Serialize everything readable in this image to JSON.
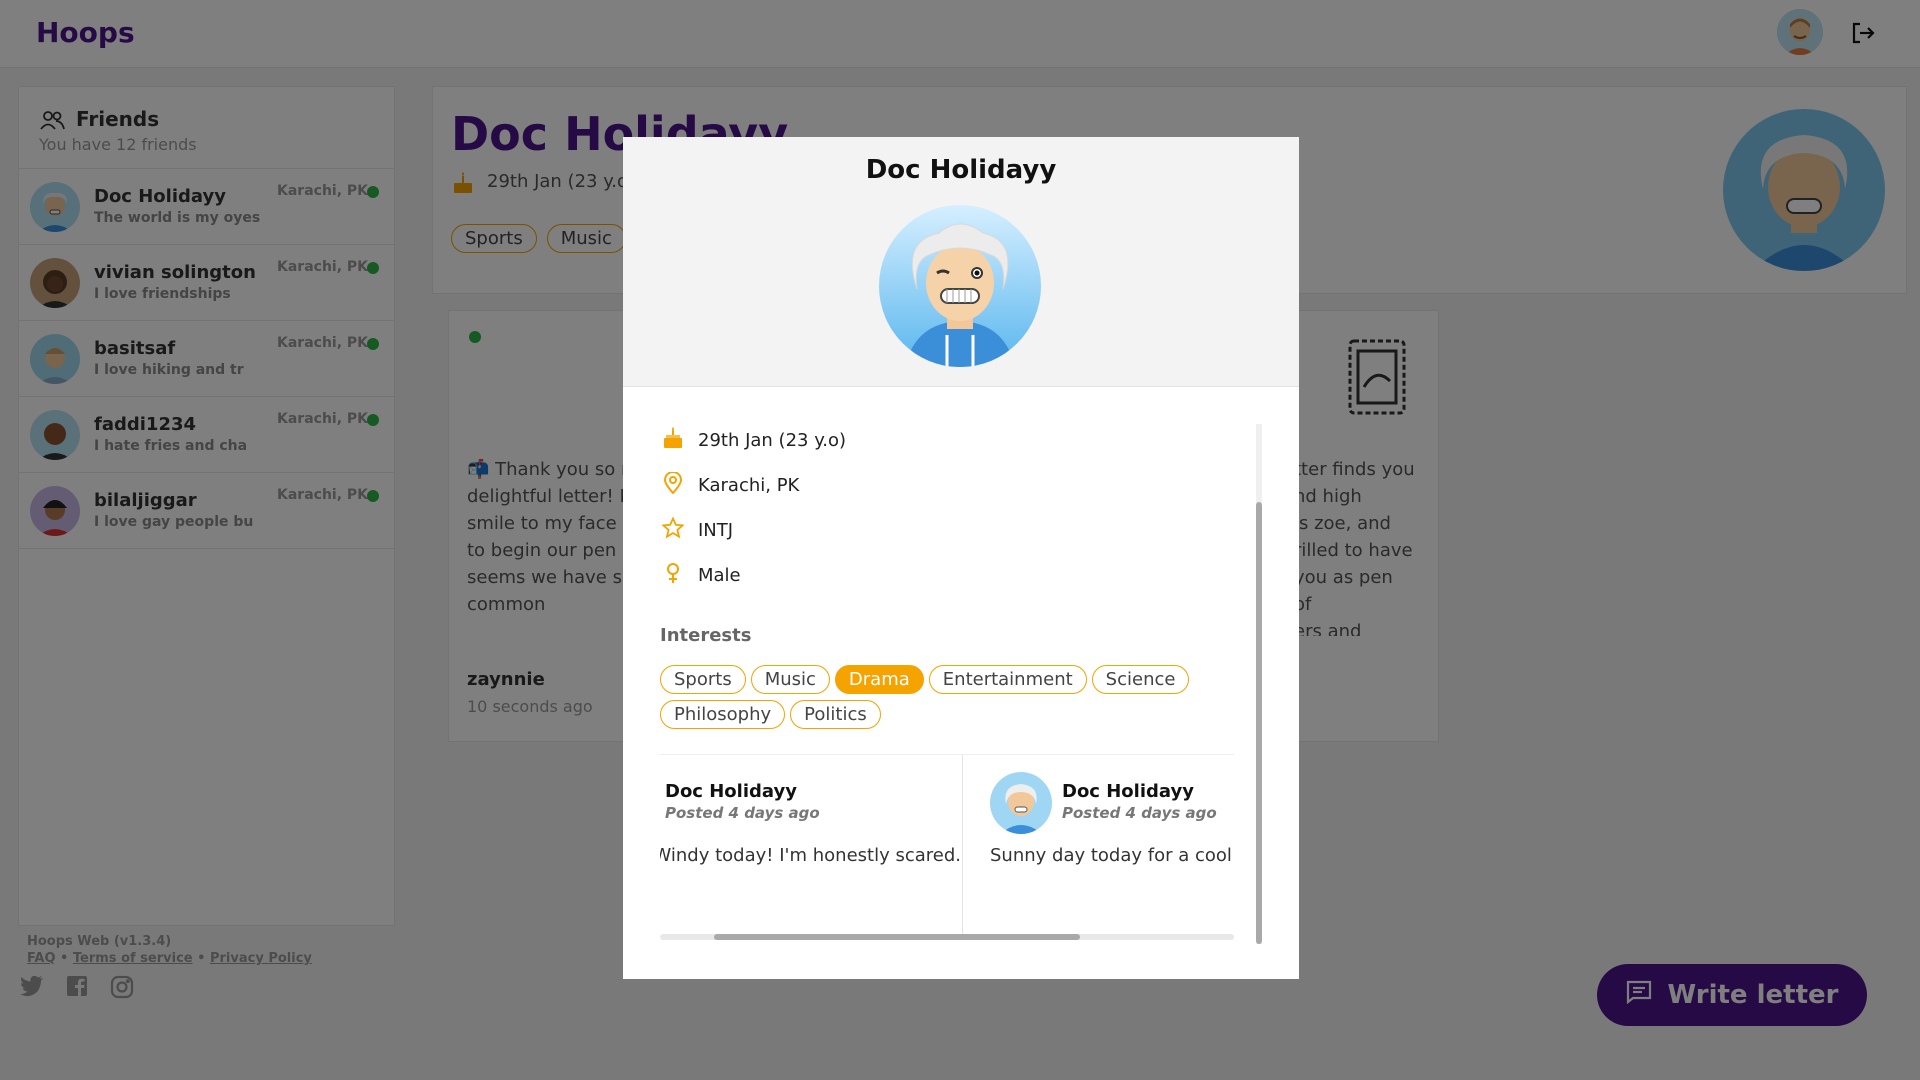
{
  "app": {
    "name": "Hoops"
  },
  "sidebar": {
    "title": "Friends",
    "subtitle": "You have 12 friends",
    "friends": [
      {
        "name": "Doc Holidayy",
        "status": "The world is my oyes",
        "location": "Karachi, PK"
      },
      {
        "name": "vivian solington",
        "status": "I love friendships",
        "location": "Karachi, PK"
      },
      {
        "name": "basitsaf",
        "status": "I love hiking and tr",
        "location": "Karachi, PK"
      },
      {
        "name": "faddi1234",
        "status": "I hate fries and cha",
        "location": "Karachi, PK"
      },
      {
        "name": "bilaljiggar",
        "status": "I love gay people bu",
        "location": "Karachi, PK"
      }
    ]
  },
  "footer": {
    "version": "Hoops Web (v1.3.4)",
    "faq": "FAQ",
    "terms": "Terms of service",
    "privacy": "Privacy Policy",
    "sep": "•"
  },
  "profile": {
    "name": "Doc Holidayy",
    "birthday": "29th Jan (23 y.o",
    "tags": [
      "Sports",
      "Music"
    ]
  },
  "letter": {
    "body_left": "📬 Thank you so much for your delightful letter! It brought a smile to my face and I'm excited to begin our pen pal journey! It seems we have some wonderful common",
    "body_right": "tter finds you\nnd high\nis zoe, and\nrilled to have\nyou as pen\nof\ners and",
    "author": "zaynnie",
    "time": "10 seconds ago"
  },
  "write_button": {
    "label": "Write letter"
  },
  "modal": {
    "title": "Doc Holidayy",
    "birthday": "29th Jan (23 y.o)",
    "location": "Karachi, PK",
    "personality": "INTJ",
    "gender": "Male",
    "interests_label": "Interests",
    "interests": [
      {
        "label": "Sports",
        "active": false
      },
      {
        "label": "Music",
        "active": false
      },
      {
        "label": "Drama",
        "active": true
      },
      {
        "label": "Entertainment",
        "active": false
      },
      {
        "label": "Science",
        "active": false
      },
      {
        "label": "Philosophy",
        "active": false
      },
      {
        "label": "Politics",
        "active": false
      }
    ],
    "posts": [
      {
        "author": "Doc Holidayy",
        "time": "Posted 4 days ago",
        "body": "Windy today! I'm honestly scared."
      },
      {
        "author": "Doc Holidayy",
        "time": "Posted 4 days ago",
        "body": "Sunny day today for a cool swim"
      }
    ]
  },
  "colors": {
    "brand": "#4a148c",
    "accent": "#f5a300",
    "online": "#2fb344"
  }
}
